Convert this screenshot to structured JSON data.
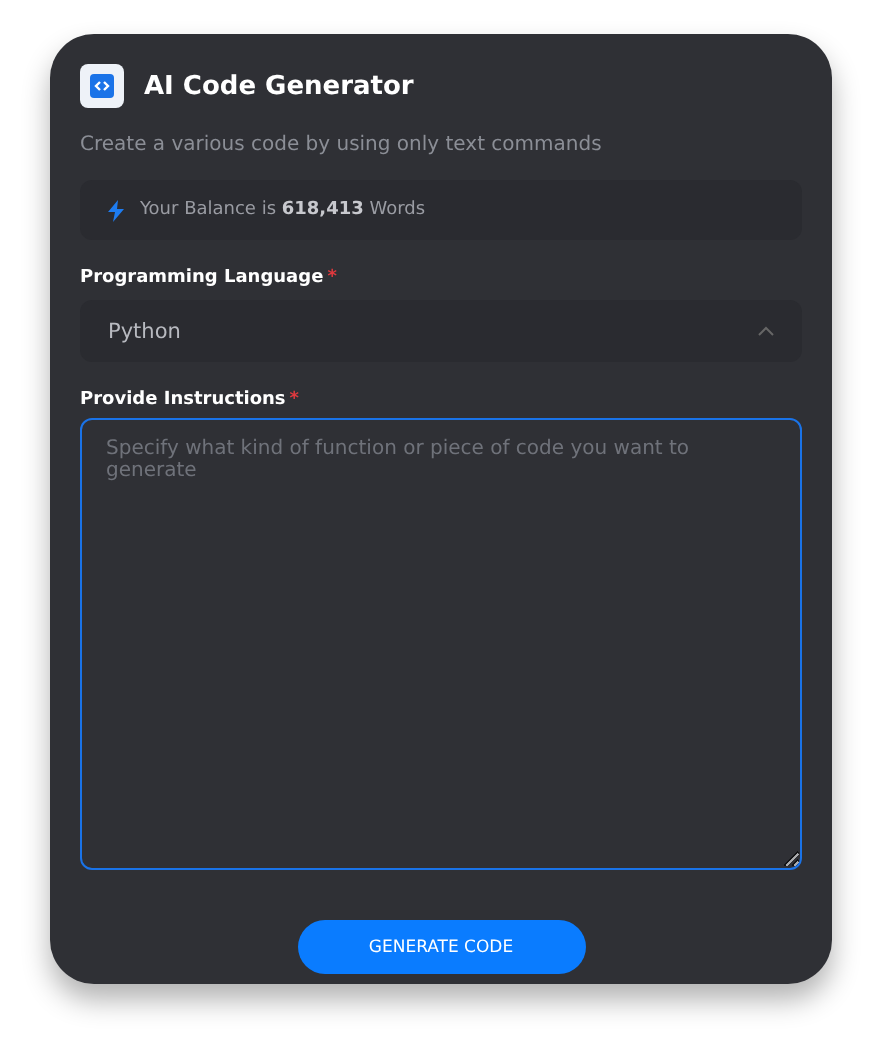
{
  "header": {
    "title": "AI Code Generator",
    "subtitle": "Create a various code by using only text commands"
  },
  "balance": {
    "text": "Your Balance is **618,413** Words"
  },
  "language": {
    "label": "Programming Language",
    "required_mark": "*",
    "value": "Python",
    "expanded": true
  },
  "instructions": {
    "label": "Provide Instructions",
    "required_mark": "*",
    "placeholder": "Specify what kind of function or piece of code you want to generate",
    "focused": true
  },
  "button": {
    "label": "GENERATE CODE"
  }
}
